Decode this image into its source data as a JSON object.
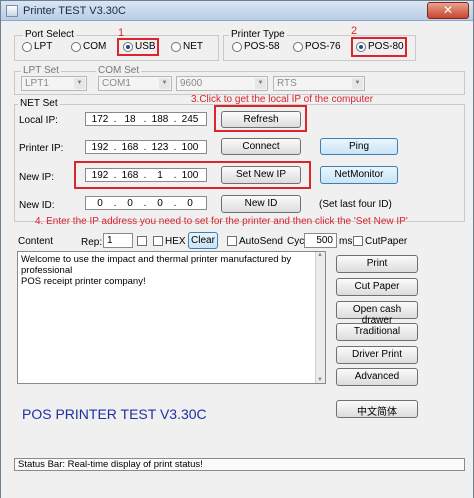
{
  "window": {
    "title": "Printer TEST V3.30C",
    "close_symbol": "✕"
  },
  "port_select": {
    "label": "Port Select",
    "options": [
      {
        "label": "LPT",
        "checked": false
      },
      {
        "label": "COM",
        "checked": false
      },
      {
        "label": "USB",
        "checked": true
      },
      {
        "label": "NET",
        "checked": false
      }
    ]
  },
  "printer_type": {
    "label": "Printer Type",
    "options": [
      {
        "label": "POS-58",
        "checked": false
      },
      {
        "label": "POS-76",
        "checked": false
      },
      {
        "label": "POS-80",
        "checked": true
      }
    ]
  },
  "lpt_set": {
    "label": "LPT Set",
    "value": "LPT1"
  },
  "com_set": {
    "label": "COM Set",
    "port": "COM1",
    "baud": "9600",
    "flow": "RTS"
  },
  "net_set": {
    "label": "NET Set",
    "local_ip": {
      "label": "Local IP:",
      "octets": [
        "172",
        "18",
        "188",
        "245"
      ]
    },
    "printer_ip": {
      "label": "Printer IP:",
      "octets": [
        "192",
        "168",
        "123",
        "100"
      ]
    },
    "new_ip": {
      "label": "New IP:",
      "octets": [
        "192",
        "168",
        "1",
        "100"
      ]
    },
    "new_id": {
      "label": "New ID:",
      "octets": [
        "0",
        "0",
        "0",
        "0"
      ]
    },
    "buttons": {
      "refresh": "Refresh",
      "connect": "Connect",
      "ping": "Ping",
      "set_new_ip": "Set New IP",
      "netmonitor": "NetMonitor",
      "new_id": "New ID"
    },
    "hint": "(Set last four ID)"
  },
  "annotations": {
    "n1": "1",
    "n2": "2",
    "step3": "3.Click to get the local IP of the computer",
    "step4": "4. Enter the IP address you need to set for the printer and then click the 'Set New IP'",
    "colors": {
      "highlight": "#d9252b"
    }
  },
  "content": {
    "label": "Content",
    "rep_label": "Rep:",
    "rep_value": "1",
    "hex_label": "HEX",
    "clear_label": "Clear",
    "autosend_label": "AutoSend",
    "cyc_label": "Cyc",
    "cyc_value": "500",
    "cyc_unit": "ms",
    "cutpaper_label": "CutPaper",
    "text_line1": "Welcome to use the impact and thermal printer manufactured by professional",
    "text_line2": "POS receipt printer company!"
  },
  "actions": [
    "Print",
    "Cut Paper",
    "Open cash drawer",
    "Traditional",
    "Driver Print",
    "Advanced"
  ],
  "language_button": "中文简体",
  "big_title": "POS PRINTER TEST V3.30C",
  "status_bar": "Status Bar: Real-time display of print status!",
  "colors": {
    "accent_title": "#1f2f9f",
    "window_bg": "#f0f0f0"
  }
}
